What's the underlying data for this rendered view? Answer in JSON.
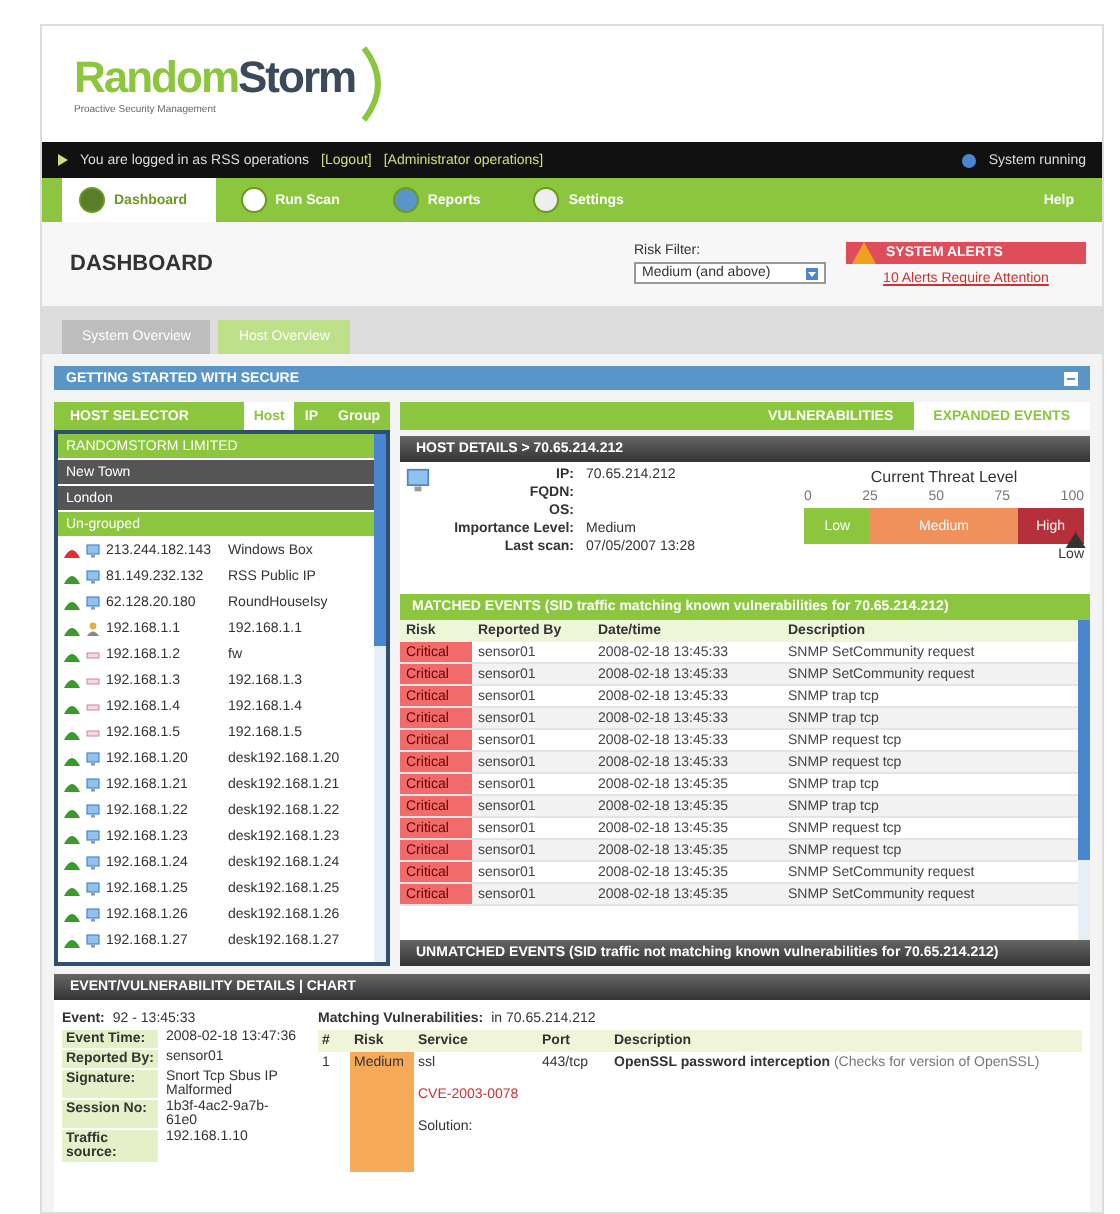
{
  "brand": {
    "name_a": "Random",
    "name_b": "Storm",
    "tagline": "Proactive Security Management"
  },
  "top_bar": {
    "message": "You are logged in as RSS operations",
    "links": [
      "[Logout]",
      "[Administrator operations]"
    ],
    "status": "System running"
  },
  "nav": [
    {
      "label": "Dashboard",
      "selected": true
    },
    {
      "label": "Run Scan",
      "selected": false
    },
    {
      "label": "Reports",
      "selected": false
    },
    {
      "label": "Settings",
      "selected": false
    }
  ],
  "help": {
    "label": "Help"
  },
  "page": {
    "title": "DASHBOARD",
    "filter_label": "Risk Filter:",
    "filter_value": "Medium (and above)",
    "alert_title": "SYSTEM ALERTS",
    "alert_link": "10 Alerts Require Attention"
  },
  "sub_tabs": [
    {
      "label": "System Overview",
      "selected": false
    },
    {
      "label": "Host Overview",
      "selected": true
    }
  ],
  "banner": "GETTING STARTED WITH SECURE",
  "host_selector": {
    "title": "HOST SELECTOR",
    "tabs": [
      {
        "label": "Host",
        "selected": true
      },
      {
        "label": "IP",
        "selected": false
      },
      {
        "label": "Group",
        "selected": false
      }
    ],
    "org": "RANDOMSTORM LIMITED",
    "groups": [
      "New Town",
      "London"
    ],
    "ungrouped": "Un-grouped",
    "hosts": [
      {
        "online": false,
        "kind": "monitor",
        "ip": "213.244.182.143",
        "name": "Windows Box"
      },
      {
        "online": true,
        "kind": "monitor",
        "ip": "81.149.232.132",
        "name": "RSS Public IP"
      },
      {
        "online": true,
        "kind": "monitor",
        "ip": "62.128.20.180",
        "name": "RoundHouseIsy"
      },
      {
        "online": true,
        "kind": "user",
        "ip": "192.168.1.1",
        "name": "192.168.1.1"
      },
      {
        "online": true,
        "kind": "network",
        "ip": "192.168.1.2",
        "name": "fw"
      },
      {
        "online": true,
        "kind": "network",
        "ip": "192.168.1.3",
        "name": "192.168.1.3"
      },
      {
        "online": true,
        "kind": "network",
        "ip": "192.168.1.4",
        "name": "192.168.1.4"
      },
      {
        "online": true,
        "kind": "network",
        "ip": "192.168.1.5",
        "name": "192.168.1.5"
      },
      {
        "online": true,
        "kind": "monitor",
        "ip": "192.168.1.20",
        "name": "desk192.168.1.20"
      },
      {
        "online": true,
        "kind": "monitor",
        "ip": "192.168.1.21",
        "name": "desk192.168.1.21"
      },
      {
        "online": true,
        "kind": "monitor",
        "ip": "192.168.1.22",
        "name": "desk192.168.1.22"
      },
      {
        "online": true,
        "kind": "monitor",
        "ip": "192.168.1.23",
        "name": "desk192.168.1.23"
      },
      {
        "online": true,
        "kind": "monitor",
        "ip": "192.168.1.24",
        "name": "desk192.168.1.24"
      },
      {
        "online": true,
        "kind": "monitor",
        "ip": "192.168.1.25",
        "name": "desk192.168.1.25"
      },
      {
        "online": true,
        "kind": "monitor",
        "ip": "192.168.1.26",
        "name": "desk192.168.1.26"
      },
      {
        "online": true,
        "kind": "monitor",
        "ip": "192.168.1.27",
        "name": "desk192.168.1.27"
      }
    ]
  },
  "right_tabs": [
    {
      "label": "VULNERABILITIES",
      "selected": false
    },
    {
      "label": "EXPANDED EVENTS",
      "selected": true
    }
  ],
  "host_details": {
    "title": "HOST DETAILS > 70.65.214.212",
    "fields": [
      {
        "label": "IP:",
        "value": "70.65.214.212"
      },
      {
        "label": "FQDN:"
      },
      {
        "label": "OS:"
      },
      {
        "label": "Importance Level:",
        "value": "Medium"
      },
      {
        "label": "Last scan:",
        "value": "07/05/2007 13:28"
      }
    ]
  },
  "threat": {
    "title": "Current Threat Level",
    "ticks": [
      "0",
      "25",
      "50",
      "75",
      "100"
    ],
    "segments": [
      {
        "label": "Low",
        "kind": "low"
      },
      {
        "label": "Medium",
        "kind": "medium"
      },
      {
        "label": "High",
        "kind": "high"
      }
    ],
    "level": 0.97,
    "marker_label": "Low"
  },
  "matched": {
    "title": "MATCHED EVENTS (SID traffic matching known vulnerabilities for 70.65.214.212)",
    "columns": [
      "Risk",
      "Reported By",
      "Date/time",
      "Description"
    ],
    "rows": [
      [
        "Critical",
        "sensor01",
        "2008-02-18 13:45:33",
        "SNMP SetCommunity request"
      ],
      [
        "Critical",
        "sensor01",
        "2008-02-18 13:45:33",
        "SNMP SetCommunity request"
      ],
      [
        "Critical",
        "sensor01",
        "2008-02-18 13:45:33",
        "SNMP trap tcp"
      ],
      [
        "Critical",
        "sensor01",
        "2008-02-18 13:45:33",
        "SNMP trap tcp"
      ],
      [
        "Critical",
        "sensor01",
        "2008-02-18 13:45:33",
        "SNMP request tcp"
      ],
      [
        "Critical",
        "sensor01",
        "2008-02-18 13:45:33",
        "SNMP request tcp"
      ],
      [
        "Critical",
        "sensor01",
        "2008-02-18 13:45:35",
        "SNMP trap tcp"
      ],
      [
        "Critical",
        "sensor01",
        "2008-02-18 13:45:35",
        "SNMP trap tcp"
      ],
      [
        "Critical",
        "sensor01",
        "2008-02-18 13:45:35",
        "SNMP request tcp"
      ],
      [
        "Critical",
        "sensor01",
        "2008-02-18 13:45:35",
        "SNMP request tcp"
      ],
      [
        "Critical",
        "sensor01",
        "2008-02-18 13:45:35",
        "SNMP SetCommunity request"
      ],
      [
        "Critical",
        "sensor01",
        "2008-02-18 13:45:35",
        "SNMP SetCommunity request"
      ]
    ]
  },
  "unmatched": "UNMATCHED EVENTS (SID traffic not matching known vulnerabilities for 70.65.214.212)",
  "details": {
    "title": "EVENT/VULNERABILITY DETAILS | CHART",
    "event_label": "Event:",
    "event_value": "92 - 13:45:33",
    "fields": [
      {
        "label": "Event Time:",
        "value": "2008-02-18 13:47:36"
      },
      {
        "label": "Reported By:",
        "value": "sensor01"
      },
      {
        "label": "Signature:",
        "value": "Snort Tcp Sbus IP Malformed"
      },
      {
        "label": "Session No:",
        "value": "1b3f-4ac2-9a7b-61e0"
      },
      {
        "label": "Traffic source:",
        "value": "192.168.1.10"
      }
    ],
    "vuln_label": "Matching Vulnerabilities:",
    "vuln_host": "in 70.65.214.212",
    "columns": [
      "#",
      "Risk",
      "Service",
      "Port",
      "Description"
    ],
    "rows": [
      {
        "num": "1",
        "risk": "Medium",
        "service": "ssl",
        "port": "443/tcp",
        "title": "OpenSSL password interception",
        "note": "(Checks for version of OpenSSL)",
        "ref": "CVE-2003-0078",
        "extra": "Solution:"
      }
    ]
  }
}
